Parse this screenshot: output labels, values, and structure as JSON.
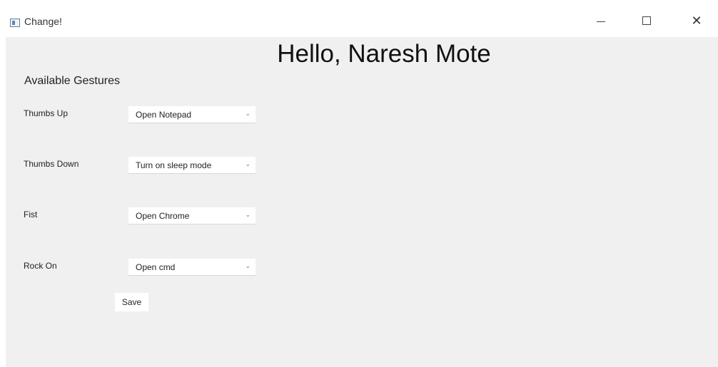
{
  "window": {
    "title": "Change!",
    "minimize_icon": "minimize-icon",
    "maximize_icon": "maximize-icon",
    "close_icon": "close-icon",
    "close_glyph": "✕"
  },
  "main": {
    "greeting": "Hello, Naresh Mote",
    "section_title": "Available Gestures",
    "gestures": [
      {
        "label": "Thumbs Up",
        "action": "Open Notepad"
      },
      {
        "label": "Thumbs Down",
        "action": "Turn on sleep mode"
      },
      {
        "label": "Fist",
        "action": "Open Chrome"
      },
      {
        "label": "Rock On",
        "action": "Open cmd"
      }
    ],
    "save_label": "Save",
    "chevron_glyph": "⌄"
  }
}
